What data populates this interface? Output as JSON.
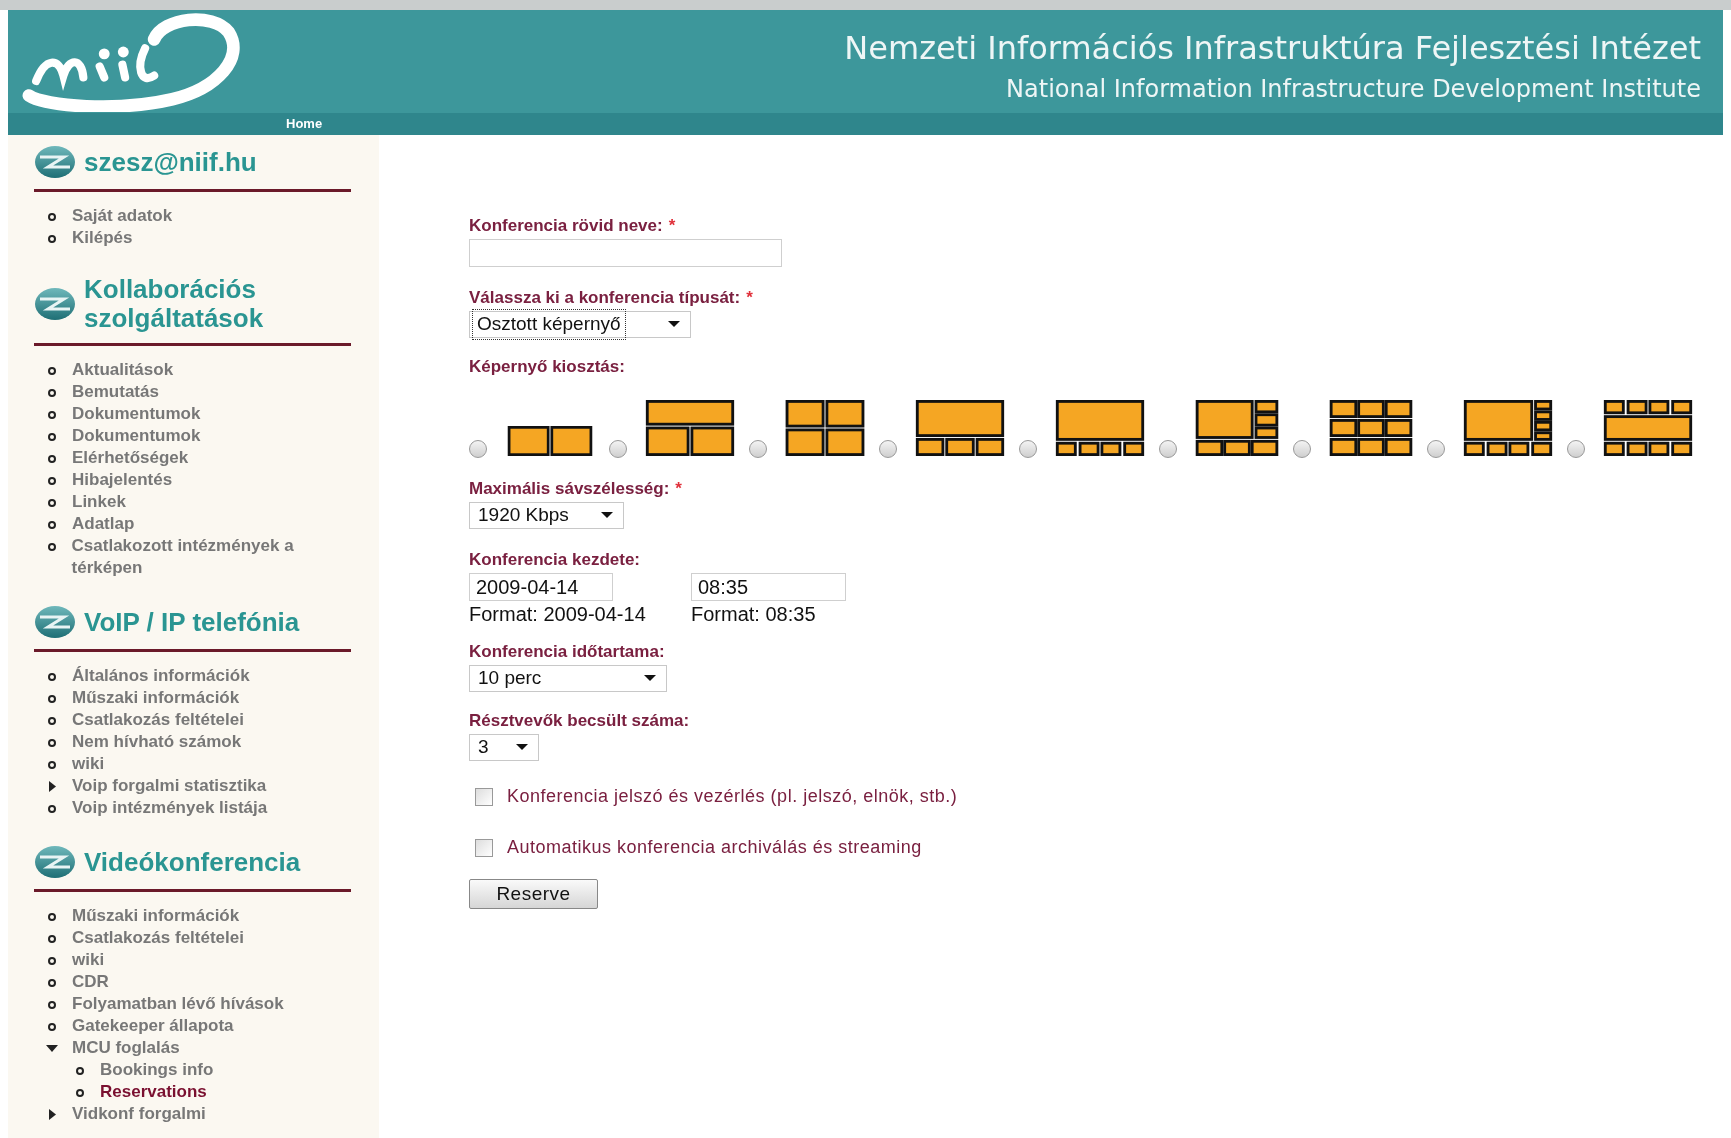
{
  "header": {
    "title": "Nemzeti Információs Infrastruktúra Fejlesztési Intézet",
    "subtitle": "National Information Infrastructure Development Institute",
    "nav": [
      "Home"
    ]
  },
  "sidebar": {
    "sections": [
      {
        "title": "szesz@niif.hu",
        "items": [
          {
            "label": "Saját adatok",
            "kind": "leaf",
            "selected": false
          },
          {
            "label": "Kilépés",
            "kind": "leaf",
            "selected": false
          }
        ]
      },
      {
        "title": "Kollaborációs szolgáltatások",
        "items": [
          {
            "label": "Aktualitások",
            "kind": "leaf",
            "selected": false
          },
          {
            "label": "Bemutatás",
            "kind": "leaf",
            "selected": false
          },
          {
            "label": "Dokumentumok",
            "kind": "leaf",
            "selected": false
          },
          {
            "label": "Dokumentumok",
            "kind": "leaf",
            "selected": false
          },
          {
            "label": "Elérhetőségek",
            "kind": "leaf",
            "selected": false
          },
          {
            "label": "Hibajelentés",
            "kind": "leaf",
            "selected": false
          },
          {
            "label": "Linkek",
            "kind": "leaf",
            "selected": false
          },
          {
            "label": "Adatlap",
            "kind": "leaf",
            "selected": false
          },
          {
            "label": "Csatlakozott intézmények a térképen",
            "kind": "leaf",
            "selected": false
          }
        ]
      },
      {
        "title": "VoIP / IP telefónia",
        "items": [
          {
            "label": "Általános információk",
            "kind": "leaf",
            "selected": false
          },
          {
            "label": "Műszaki információk",
            "kind": "leaf",
            "selected": false
          },
          {
            "label": "Csatlakozás feltételei",
            "kind": "leaf",
            "selected": false
          },
          {
            "label": "Nem hívható számok",
            "kind": "leaf",
            "selected": false
          },
          {
            "label": "wiki",
            "kind": "leaf",
            "selected": false
          },
          {
            "label": "Voip forgalmi statisztika",
            "kind": "branch",
            "expanded": false,
            "selected": false
          },
          {
            "label": "Voip intézmények listája",
            "kind": "leaf",
            "selected": false
          }
        ]
      },
      {
        "title": "Videókonferencia",
        "items": [
          {
            "label": "Műszaki információk",
            "kind": "leaf",
            "selected": false
          },
          {
            "label": "Csatlakozás feltételei",
            "kind": "leaf",
            "selected": false
          },
          {
            "label": "wiki",
            "kind": "leaf",
            "selected": false
          },
          {
            "label": "CDR",
            "kind": "leaf",
            "selected": false
          },
          {
            "label": "Folyamatban lévő hívások",
            "kind": "leaf",
            "selected": false
          },
          {
            "label": "Gatekeeper állapota",
            "kind": "leaf",
            "selected": false
          },
          {
            "label": "MCU foglalás",
            "kind": "branch",
            "expanded": true,
            "selected": false,
            "children": [
              {
                "label": "Bookings info",
                "kind": "leaf",
                "selected": false
              },
              {
                "label": "Reservations",
                "kind": "leaf",
                "selected": true
              }
            ]
          },
          {
            "label": "Vidkonf forgalmi",
            "kind": "branch",
            "expanded": false,
            "selected": false
          }
        ]
      }
    ]
  },
  "form": {
    "name": {
      "label": "Konferencia rövid neve:",
      "required_mark": "*"
    },
    "type": {
      "label": "Válassza ki a konferencia típusát:",
      "required_mark": "*",
      "value": "Osztott képernyő"
    },
    "layout": {
      "label": "Képernyő kiosztás:",
      "options": [
        {
          "kind": "duo",
          "selected": false
        },
        {
          "kind": "trio",
          "selected": false
        },
        {
          "kind": "quad",
          "selected": false
        },
        {
          "kind": "quartet",
          "selected": false
        },
        {
          "kind": "quintet",
          "selected": false
        },
        {
          "kind": "sextet",
          "selected": false
        },
        {
          "kind": "nonet",
          "selected": false
        },
        {
          "kind": "octet",
          "selected": false
        },
        {
          "kind": "strip",
          "selected": false
        }
      ]
    },
    "bandwidth": {
      "label": "Maximális sávszélesség:",
      "required_mark": "*",
      "value": "1920 Kbps"
    },
    "start": {
      "label": "Konferencia kezdete:",
      "date": "2009-04-14",
      "time": "08:35",
      "date_hint": "Format: 2009-04-14",
      "time_hint": "Format: 08:35"
    },
    "duration": {
      "label": "Konferencia időtartama:",
      "value": "10 perc"
    },
    "participants": {
      "label": "Résztvevők becsült száma:",
      "value": "3"
    },
    "options": [
      {
        "label": "Konferencia jelszó és vezérlés (pl. jelszó, elnök, stb.)",
        "checked": false
      },
      {
        "label": "Automatikus konferencia archiválás és streaming",
        "checked": false
      }
    ],
    "submit": "Reserve"
  }
}
